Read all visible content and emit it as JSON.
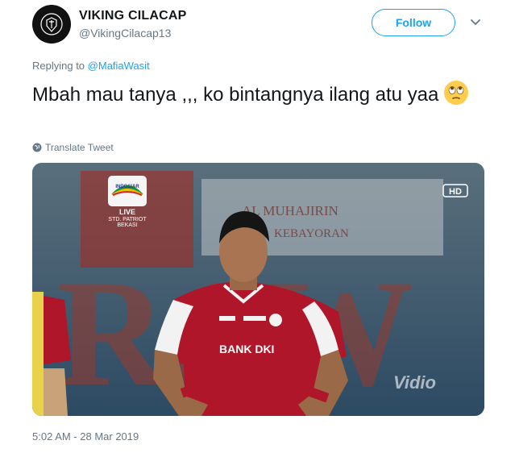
{
  "tweet": {
    "author_name": "VIKING CILACAP",
    "author_handle": "@VikingCilacap13",
    "follow_label": "Follow",
    "replying_prefix": "Replying to",
    "replying_mention": "@MafiaWasit",
    "text": "Mbah mau tanya ,,, ko bintangnya ilang atu yaa",
    "emoji": "rolling-eyes-emoji",
    "translate_label": "Translate Tweet",
    "timestamp": "5:02 AM - 28 Mar 2019"
  },
  "media": {
    "broadcaster": "INDOSIAR",
    "live_label": "LIVE",
    "location_line1": "STD. PATRIOT",
    "location_line2": "BEKASI",
    "hd_badge": "HD",
    "watermark": "Vidio",
    "jersey_sponsor": "BANK DKI",
    "banner_text_1": "AL MUHAJIRIN",
    "banner_text_2": "KEBAYORAN",
    "stand_letters": "RAW"
  },
  "colors": {
    "accent": "#1da1f2",
    "text": "#14171a",
    "muted": "#657786",
    "jersey_red": "#b0162a"
  }
}
